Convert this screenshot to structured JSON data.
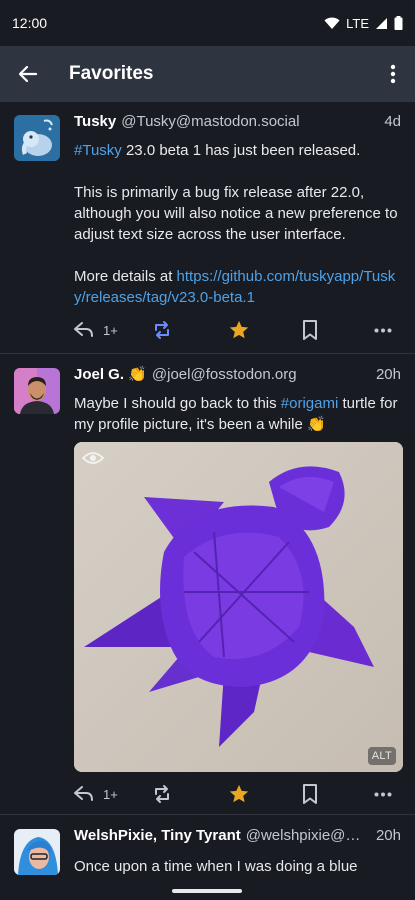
{
  "status_bar": {
    "time": "12:00",
    "network": "LTE"
  },
  "toolbar": {
    "title": "Favorites"
  },
  "statuses": [
    {
      "display_name": "Tusky",
      "username": "@Tusky@mastodon.social",
      "time": "4d",
      "hashtag": "#Tusky",
      "line1_rest": " 23.0 beta 1 has just been released.",
      "para2": "This is primarily a bug fix release after 22.0, although you will also notice a new preference to adjust text size across the user interface.",
      "para3_prefix": "More details at ",
      "link": "https://github.com/tuskyapp/Tusky/releases/tag/v23.0-beta.1",
      "reply_count": "1+"
    },
    {
      "display_name": "Joel G.",
      "display_emoji": "👏",
      "username": "@joel@fosstodon.org",
      "time": "20h",
      "text_before": "Maybe I should go back to this ",
      "hashtag": "#origami",
      "text_after": " turtle for my profile picture, it's been a while ",
      "text_emoji": "👏",
      "media_alt_badge": "ALT",
      "reply_count": "1+"
    },
    {
      "display_name": "WelshPixie, Tiny Tyrant",
      "username": "@welshpixie@ma...",
      "time": "20h",
      "text": "Once upon a time when I was doing a blue"
    }
  ],
  "colors": {
    "accent": "#4ea2e8",
    "favourite": "#e8a622",
    "boost": "#6a8cff",
    "toolbar": "#2f3441",
    "background": "#191b22"
  },
  "icons": [
    "back-arrow-icon",
    "overflow-menu-icon",
    "reply-icon",
    "boost-icon",
    "star-icon",
    "bookmark-icon",
    "more-icon",
    "eye-icon",
    "wifi-icon",
    "signal-icon",
    "battery-icon"
  ]
}
